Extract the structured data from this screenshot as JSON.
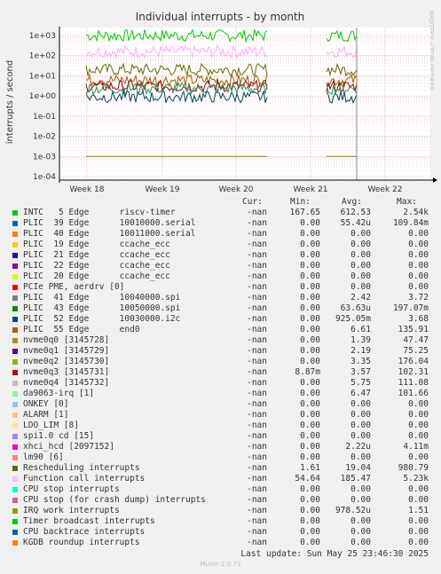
{
  "chart_data": {
    "type": "line",
    "title": "Individual interrupts - by month",
    "ylabel": "interrupts / second",
    "side_label": "RRDTOOL / TOBI OETIKER",
    "yscale": "log",
    "yticks": [
      "1e-04",
      "1e-03",
      "1e-02",
      "1e-01",
      "1e+00",
      "1e+01",
      "1e+02",
      "1e+03"
    ],
    "xticks": [
      "Week 18",
      "Week 19",
      "Week 20",
      "Week 21",
      "Week 22"
    ],
    "series": [
      {
        "name": "INTC   5 Edge      riscv-timer",
        "color": "#00cc00",
        "level": 1000
      },
      {
        "name": "Function call interrupts",
        "color": "#ffaaff",
        "level": 160
      },
      {
        "name": "Rescheduling interrupts",
        "color": "#666600",
        "level": 20
      },
      {
        "name": "PLIC  55 Edge      end0",
        "color": "#a05a00",
        "level": 6
      },
      {
        "name": "nvme0q3 [3145731]",
        "color": "#990000",
        "level": 3
      },
      {
        "name": "PLIC  41 Edge      10040000.spi",
        "color": "#2e8b57",
        "level": 2.4
      },
      {
        "name": "PLIC  52 Edge      10030000.i2c",
        "color": "#004466",
        "level": 0.9
      },
      {
        "name": "IRQ work interrupts",
        "color": "#888800",
        "level": 0.001
      }
    ]
  },
  "legend": {
    "headers": {
      "cur": "Cur:",
      "min": "Min:",
      "avg": "Avg:",
      "max": "Max:"
    },
    "rows": [
      {
        "name": "INTC   5 Edge      riscv-timer",
        "color": "#00cc00",
        "cur": "-nan",
        "min": "167.65",
        "avg": "612.53",
        "max": "2.54k"
      },
      {
        "name": "PLIC  39 Edge      10010000.serial",
        "color": "#0066b3",
        "cur": "-nan",
        "min": "0.00",
        "avg": "55.42u",
        "max": "109.84m"
      },
      {
        "name": "PLIC  40 Edge      10011000.serial",
        "color": "#ff8000",
        "cur": "-nan",
        "min": "0.00",
        "avg": "0.00",
        "max": "0.00"
      },
      {
        "name": "PLIC  19 Edge      ccache_ecc",
        "color": "#ffcc00",
        "cur": "-nan",
        "min": "0.00",
        "avg": "0.00",
        "max": "0.00"
      },
      {
        "name": "PLIC  21 Edge      ccache_ecc",
        "color": "#330099",
        "cur": "-nan",
        "min": "0.00",
        "avg": "0.00",
        "max": "0.00"
      },
      {
        "name": "PLIC  22 Edge      ccache_ecc",
        "color": "#990099",
        "cur": "-nan",
        "min": "0.00",
        "avg": "0.00",
        "max": "0.00"
      },
      {
        "name": "PLIC  20 Edge      ccache_ecc",
        "color": "#ccff00",
        "cur": "-nan",
        "min": "0.00",
        "avg": "0.00",
        "max": "0.00"
      },
      {
        "name": "PCIe PME, aerdrv [0]",
        "color": "#ff0000",
        "cur": "-nan",
        "min": "0.00",
        "avg": "0.00",
        "max": "0.00"
      },
      {
        "name": "PLIC  41 Edge      10040000.spi",
        "color": "#808080",
        "cur": "-nan",
        "min": "0.00",
        "avg": "2.42",
        "max": "3.72"
      },
      {
        "name": "PLIC  43 Edge      10050000.spi",
        "color": "#008f00",
        "cur": "-nan",
        "min": "0.00",
        "avg": "63.63u",
        "max": "197.07m"
      },
      {
        "name": "PLIC  52 Edge      10030000.i2c",
        "color": "#00487d",
        "cur": "-nan",
        "min": "0.00",
        "avg": "925.05m",
        "max": "3.68"
      },
      {
        "name": "PLIC  55 Edge      end0",
        "color": "#b35a00",
        "cur": "-nan",
        "min": "0.00",
        "avg": "6.61",
        "max": "135.91"
      },
      {
        "name": "nvme0q0 [3145728]",
        "color": "#b38f00",
        "cur": "-nan",
        "min": "0.00",
        "avg": "1.39",
        "max": "47.47"
      },
      {
        "name": "nvme0q1 [3145729]",
        "color": "#6b006b",
        "cur": "-nan",
        "min": "0.00",
        "avg": "2.19",
        "max": "75.25"
      },
      {
        "name": "nvme0q2 [3145730]",
        "color": "#8fb300",
        "cur": "-nan",
        "min": "0.00",
        "avg": "3.35",
        "max": "176.04"
      },
      {
        "name": "nvme0q3 [3145731]",
        "color": "#b30000",
        "cur": "-nan",
        "min": "8.87m",
        "avg": "3.57",
        "max": "102.31"
      },
      {
        "name": "nvme0q4 [3145732]",
        "color": "#bebebe",
        "cur": "-nan",
        "min": "0.00",
        "avg": "5.75",
        "max": "111.08"
      },
      {
        "name": "da9063-irq [1]",
        "color": "#80ff80",
        "cur": "-nan",
        "min": "0.00",
        "avg": "6.47",
        "max": "101.66"
      },
      {
        "name": "ONKEY [0]",
        "color": "#80c9ff",
        "cur": "-nan",
        "min": "0.00",
        "avg": "0.00",
        "max": "0.00"
      },
      {
        "name": "ALARM [1]",
        "color": "#ffc080",
        "cur": "-nan",
        "min": "0.00",
        "avg": "0.00",
        "max": "0.00"
      },
      {
        "name": "LDO_LIM [8]",
        "color": "#ffe680",
        "cur": "-nan",
        "min": "0.00",
        "avg": "0.00",
        "max": "0.00"
      },
      {
        "name": "spi1.0 cd [15]",
        "color": "#aa80ff",
        "cur": "-nan",
        "min": "0.00",
        "avg": "0.00",
        "max": "0.00"
      },
      {
        "name": "xhci_hcd [2097152]",
        "color": "#ee00cc",
        "cur": "-nan",
        "min": "0.00",
        "avg": "2.22u",
        "max": "4.11m"
      },
      {
        "name": "lm90 [6]",
        "color": "#ff8080",
        "cur": "-nan",
        "min": "0.00",
        "avg": "0.00",
        "max": "0.00"
      },
      {
        "name": "Rescheduling interrupts",
        "color": "#666600",
        "cur": "-nan",
        "min": "1.61",
        "avg": "19.04",
        "max": "980.79"
      },
      {
        "name": "Function call interrupts",
        "color": "#ffbfff",
        "cur": "-nan",
        "min": "54.64",
        "avg": "185.47",
        "max": "5.23k"
      },
      {
        "name": "CPU stop interrupts",
        "color": "#00ffcc",
        "cur": "-nan",
        "min": "0.00",
        "avg": "0.00",
        "max": "0.00"
      },
      {
        "name": "CPU stop (for crash dump) interrupts",
        "color": "#cc6699",
        "cur": "-nan",
        "min": "0.00",
        "avg": "0.00",
        "max": "0.00"
      },
      {
        "name": "IRQ work interrupts",
        "color": "#999900",
        "cur": "-nan",
        "min": "0.00",
        "avg": "978.52u",
        "max": "1.51"
      },
      {
        "name": "Timer broadcast interrupts",
        "color": "#00cc00",
        "cur": "-nan",
        "min": "0.00",
        "avg": "0.00",
        "max": "0.00"
      },
      {
        "name": "CPU backtrace interrupts",
        "color": "#0066b3",
        "cur": "-nan",
        "min": "0.00",
        "avg": "0.00",
        "max": "0.00"
      },
      {
        "name": "KGDB roundup interrupts",
        "color": "#ff8000",
        "cur": "-nan",
        "min": "0.00",
        "avg": "0.00",
        "max": "0.00"
      }
    ]
  },
  "last_update": "Last update: Sun May 25 23:46:30 2025",
  "footer": "Munin 2.0.73"
}
